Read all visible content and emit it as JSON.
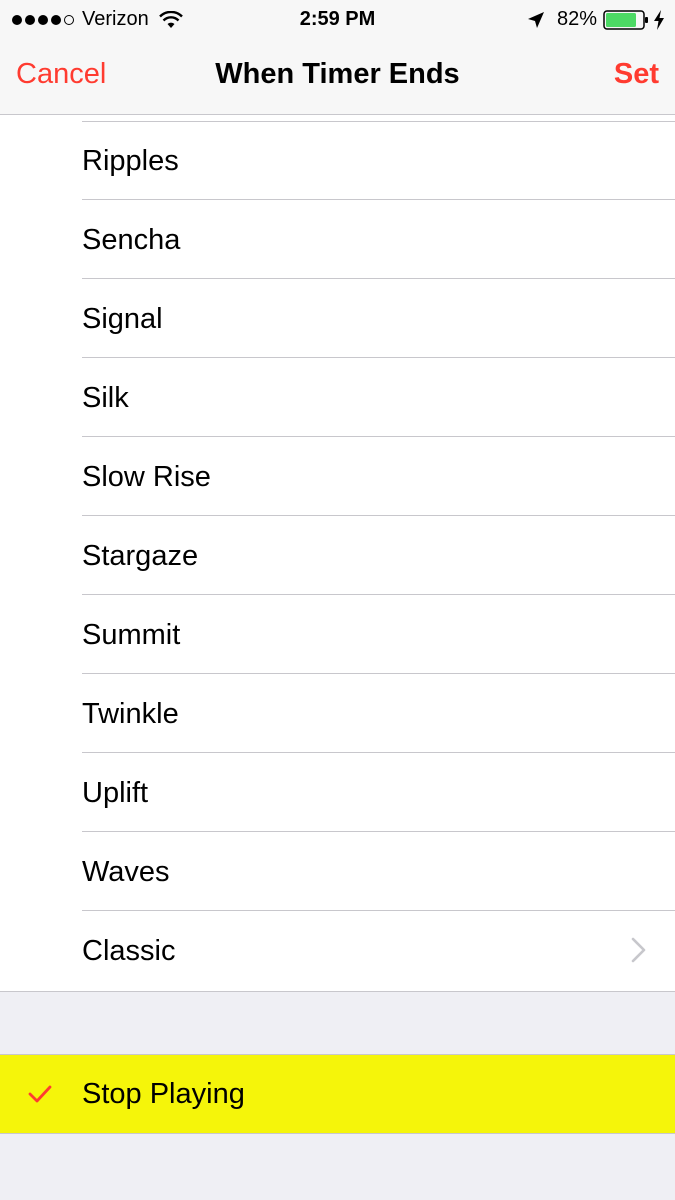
{
  "status_bar": {
    "carrier": "Verizon",
    "time": "2:59 PM",
    "battery_percent": "82%",
    "signal_bars_filled": 4,
    "signal_bars_total": 5
  },
  "nav": {
    "cancel_label": "Cancel",
    "title": "When Timer Ends",
    "set_label": "Set"
  },
  "sounds": [
    {
      "label": "Ripples"
    },
    {
      "label": "Sencha"
    },
    {
      "label": "Signal"
    },
    {
      "label": "Silk"
    },
    {
      "label": "Slow Rise"
    },
    {
      "label": "Stargaze"
    },
    {
      "label": "Summit"
    },
    {
      "label": "Twinkle"
    },
    {
      "label": "Uplift"
    },
    {
      "label": "Waves"
    },
    {
      "label": "Classic",
      "has_chevron": true
    }
  ],
  "stop_playing": {
    "label": "Stop Playing",
    "selected": true,
    "highlight_color": "#f5f50a"
  },
  "colors": {
    "accent": "#ff3b30",
    "battery": "#4cd964"
  }
}
